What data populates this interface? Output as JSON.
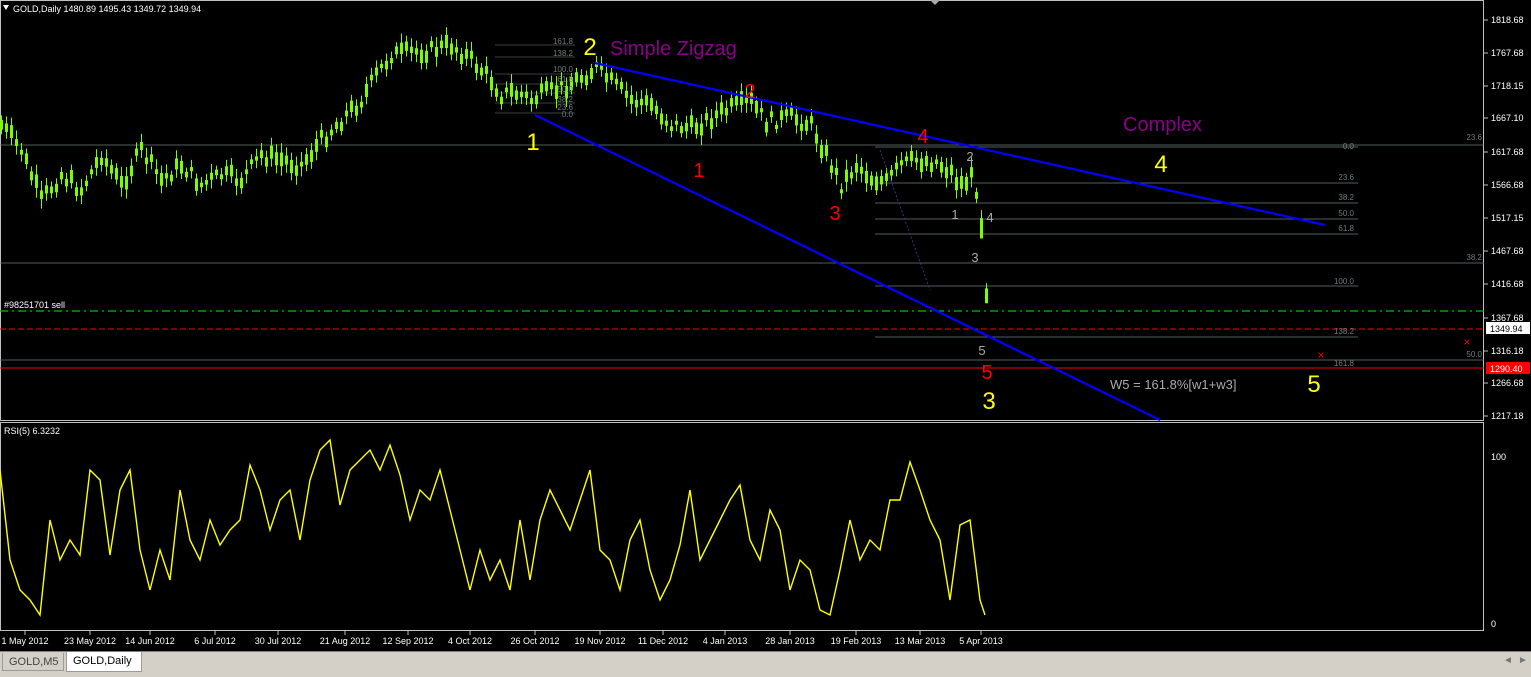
{
  "colors": {
    "background": "#000000",
    "candle": "#7CFC00",
    "trendline": "#0000FF",
    "rsi_line": "#FFFF00",
    "wave_yellow": "#FFFF00",
    "wave_red": "#FF0000",
    "pattern_purple": "#8B008B",
    "fib_line": "#6E7E7E",
    "order_line": "#00C000",
    "stop_line": "#FF0000",
    "axis_text": "#FFFFFF"
  },
  "chart": {
    "header": "GOLD,Daily  1480.89 1495.43 1349.72 1349.94",
    "price_labels": [
      "1818.68",
      "1767.68",
      "1718.15",
      "1667.10",
      "1617.68",
      "1566.68",
      "1517.15",
      "1467.68",
      "1416.68",
      "1367.68",
      "1316.18",
      "1266.68",
      "1217.18"
    ],
    "current_price_label": "1349.94",
    "stop_price_label": "1290.40",
    "order_label": "#98251701 sell",
    "date_labels": [
      "1 May 2012",
      "23 May 2012",
      "14 Jun 2012",
      "6 Jul 2012",
      "30 Jul 2012",
      "21 Aug 2012",
      "12 Sep 2012",
      "4 Oct 2012",
      "26 Oct 2012",
      "19 Nov 2012",
      "11 Dec 2012",
      "4 Jan 2013",
      "28 Jan 2013",
      "19 Feb 2013",
      "13 Mar 2013",
      "5 Apr 2013"
    ],
    "pattern_labels": [
      "Simple Zigzag",
      "Complex"
    ],
    "formula_label": "W5 = 161.8%[w1+w3]",
    "wave_labels_yellow": [
      "1",
      "2",
      "3",
      "4",
      "5"
    ],
    "wave_labels_red": [
      "1",
      "2",
      "3",
      "4",
      "5"
    ],
    "wave_labels_grey": [
      "1",
      "2",
      "3",
      "4",
      "5"
    ],
    "fib_small_a": [
      "161.8",
      "138.2",
      "100.0",
      "61.8",
      "50.0",
      "38.2",
      "23.6",
      "0.0"
    ],
    "fib_right_a": [
      "0.0",
      "23.6",
      "38.2",
      "50.0",
      "61.8",
      "100.0",
      "138.2",
      "161.8"
    ],
    "fib_edge": [
      "23.6",
      "38.2",
      "50.0"
    ]
  },
  "rsi": {
    "label": "RSI(5) 6.3232",
    "scale_top": "100",
    "scale_bottom": "0"
  },
  "tabs": [
    {
      "label": "GOLD,M5",
      "active": false
    },
    {
      "label": "GOLD,Daily",
      "active": true
    }
  ],
  "nav": {
    "left": "◄",
    "right": "►"
  }
}
